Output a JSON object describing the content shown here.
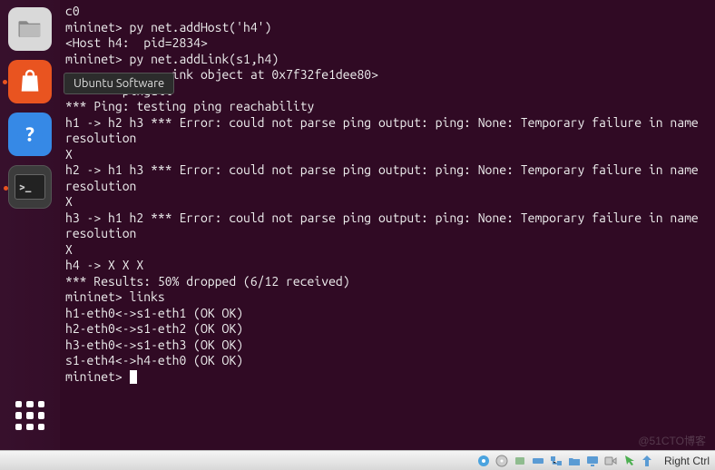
{
  "launcher": {
    "items": [
      {
        "name": "files-icon"
      },
      {
        "name": "software-icon"
      },
      {
        "name": "help-icon"
      },
      {
        "name": "terminal-icon"
      }
    ],
    "apps_label": "show-applications"
  },
  "tooltip": {
    "text": "Ubuntu Software"
  },
  "terminal": {
    "lines": [
      "c0",
      "mininet> py net.addHost('h4')",
      "<Host h4:  pid=2834>",
      "mininet> py net.addLink(s1,h4)",
      "<              ink object at 0x7f32fe1dee80>",
      "        pingall",
      "*** Ping: testing ping reachability",
      "h1 -> h2 h3 *** Error: could not parse ping output: ping: None: Temporary failure in name resolution",
      "",
      "X",
      "h2 -> h1 h3 *** Error: could not parse ping output: ping: None: Temporary failure in name resolution",
      "",
      "X",
      "h3 -> h1 h2 *** Error: could not parse ping output: ping: None: Temporary failure in name resolution",
      "",
      "X",
      "h4 -> X X X",
      "*** Results: 50% dropped (6/12 received)",
      "mininet> links",
      "h1-eth0<->s1-eth1 (OK OK)",
      "h2-eth0<->s1-eth2 (OK OK)",
      "h3-eth0<->s1-eth3 (OK OK)",
      "s1-eth4<->h4-eth0 (OK OK)"
    ],
    "prompt": "mininet> "
  },
  "taskbar": {
    "right_text": "Right Ctrl"
  },
  "watermark": "@51CTO博客"
}
